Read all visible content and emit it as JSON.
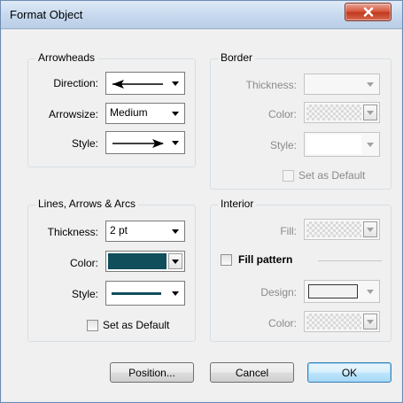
{
  "window": {
    "title": "Format Object"
  },
  "arrowheads": {
    "title": "Arrowheads",
    "direction_label": "Direction:",
    "arrowsize_label": "Arrowsize:",
    "arrowsize_value": "Medium",
    "style_label": "Style:"
  },
  "border": {
    "title": "Border",
    "thickness_label": "Thickness:",
    "color_label": "Color:",
    "style_label": "Style:",
    "set_default_label": "Set as Default"
  },
  "lines": {
    "title": "Lines, Arrows & Arcs",
    "thickness_label": "Thickness:",
    "thickness_value": "2 pt",
    "color_label": "Color:",
    "color_value": "#104e5c",
    "style_label": "Style:",
    "set_default_label": "Set as Default"
  },
  "interior": {
    "title": "Interior",
    "fill_label": "Fill:",
    "fill_pattern_label": "Fill pattern",
    "design_label": "Design:",
    "color_label": "Color:"
  },
  "buttons": {
    "position": "Position...",
    "cancel": "Cancel",
    "ok": "OK"
  }
}
